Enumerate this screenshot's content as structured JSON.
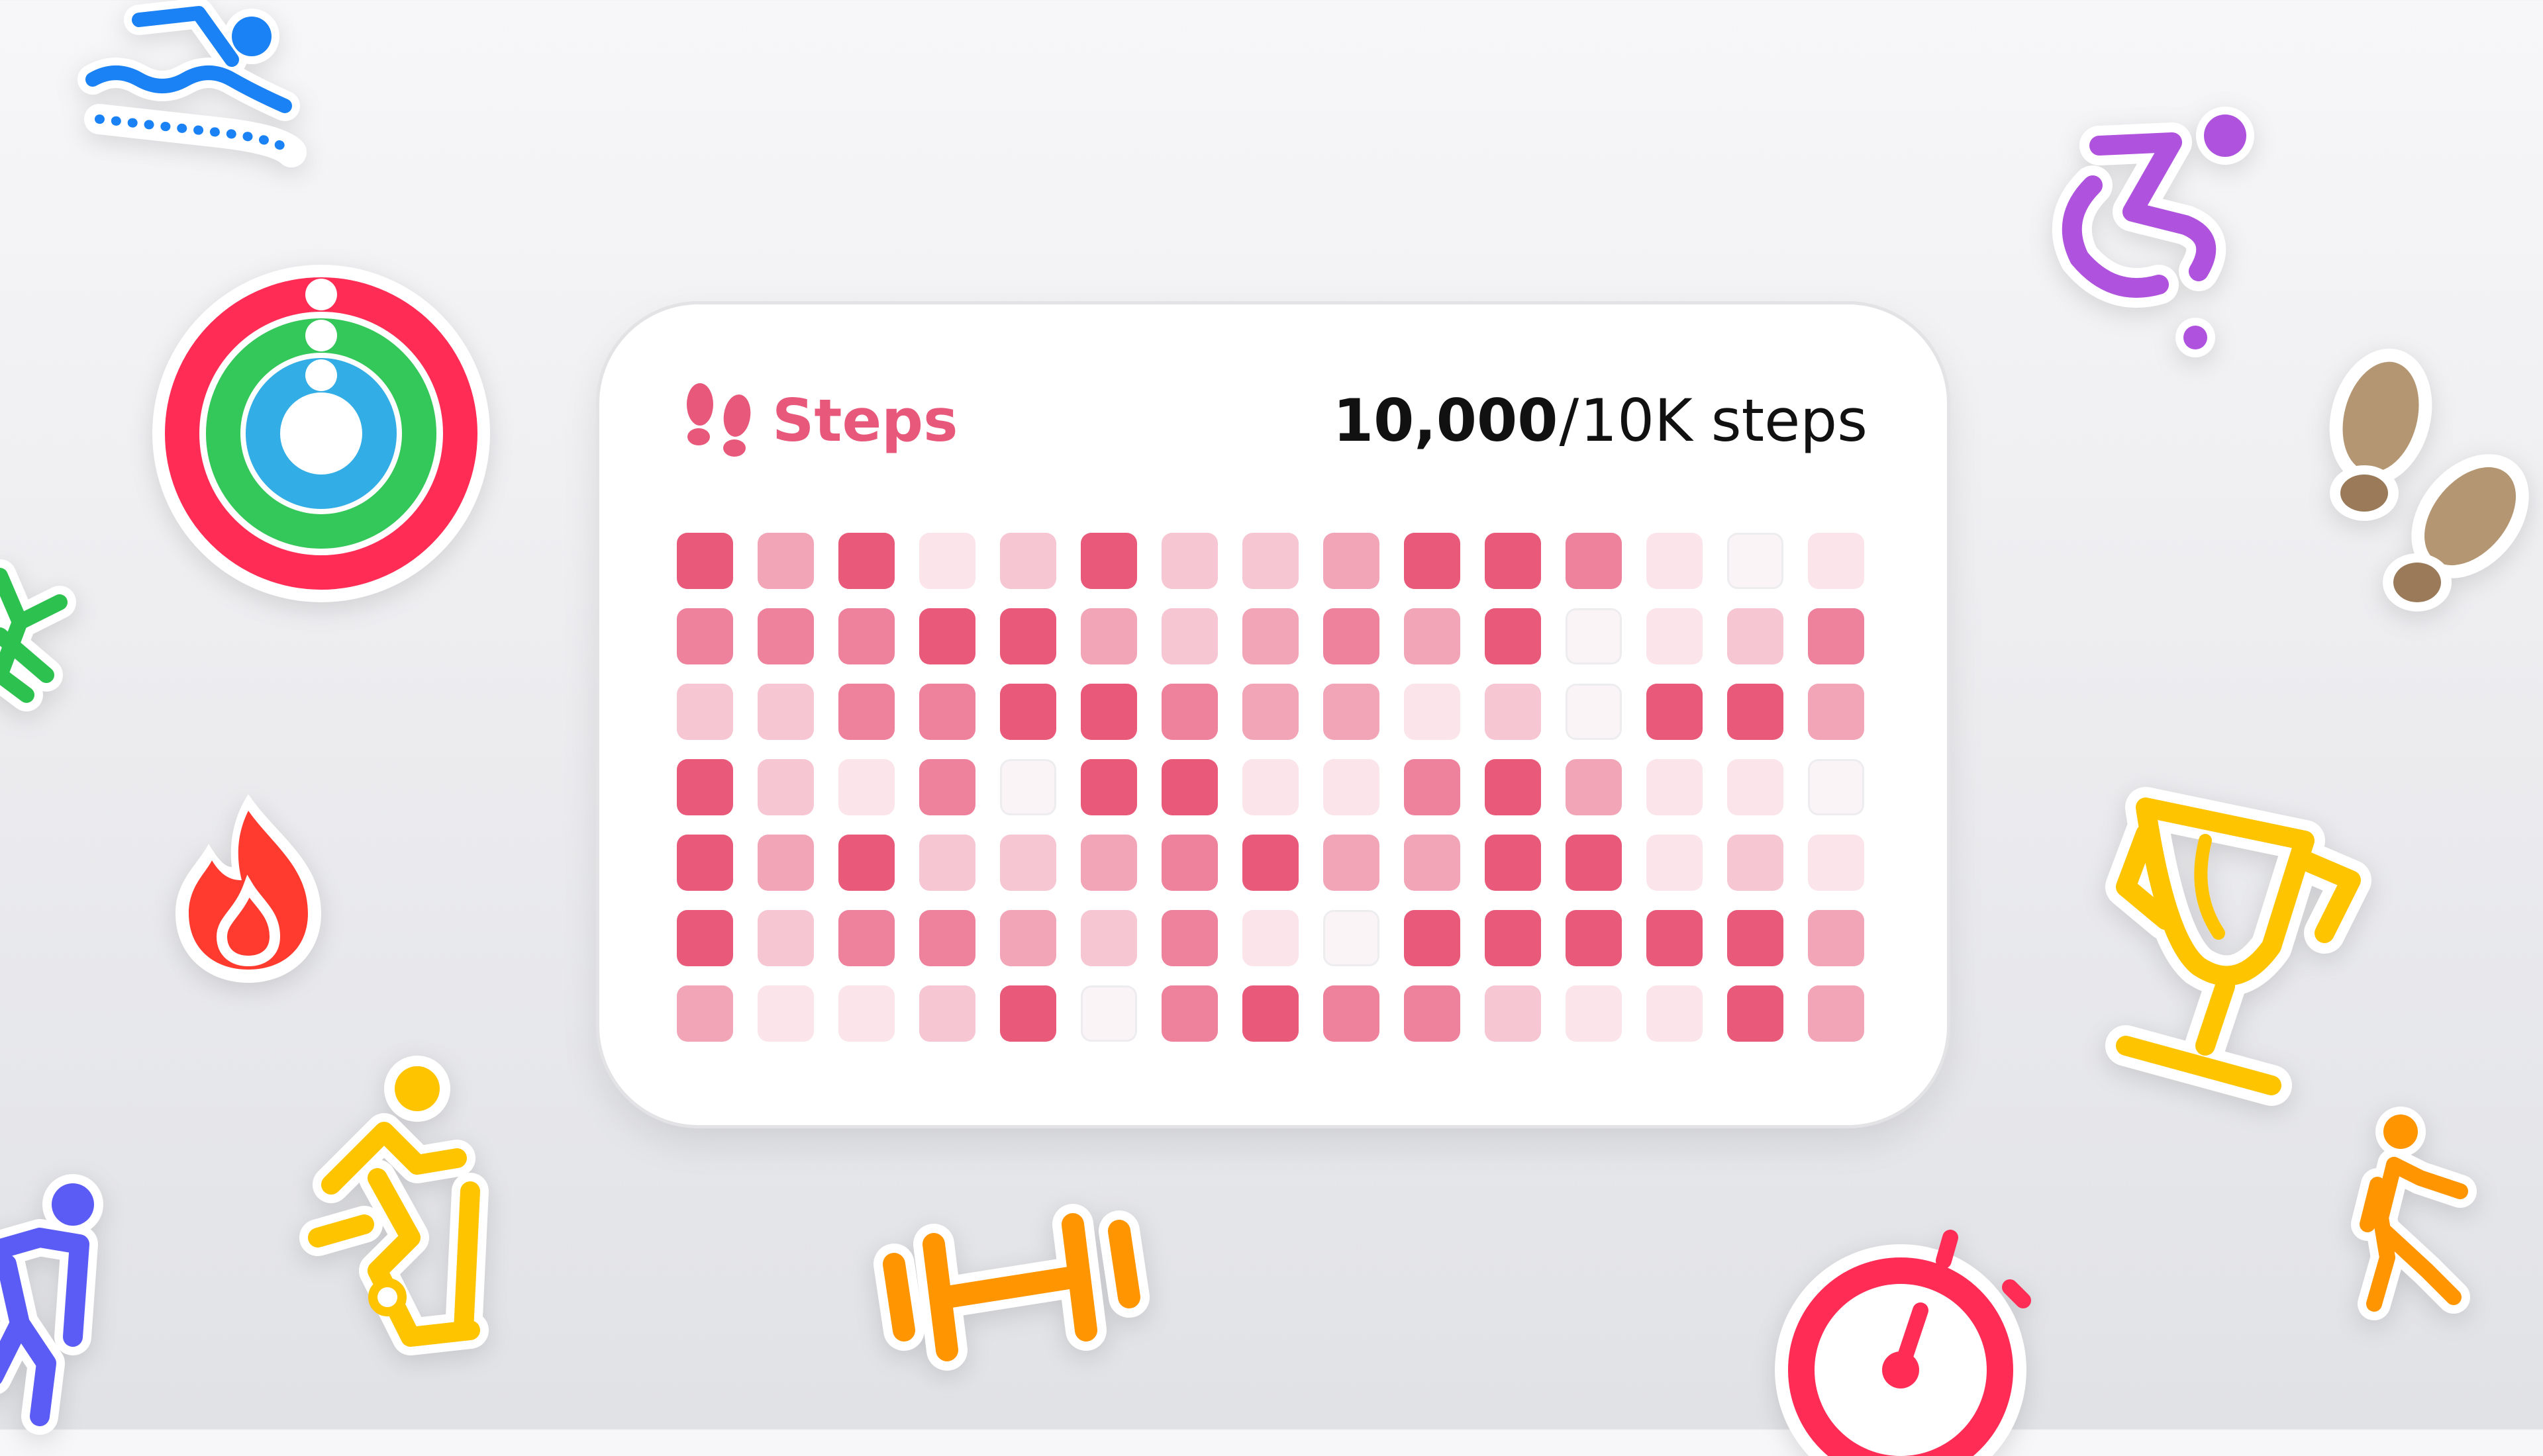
{
  "widget": {
    "title": "Steps",
    "current": "10,000",
    "separator": "/",
    "goal": "10K steps",
    "accent_color": "#e8587a"
  },
  "heatmap": {
    "rows": 7,
    "columns": 15,
    "intensity_scale": "0 = empty, 5 = full",
    "levels": [
      [
        5,
        3,
        5,
        1,
        2,
        5,
        2,
        2,
        3,
        5,
        5,
        4,
        1,
        0,
        1
      ],
      [
        4,
        4,
        4,
        5,
        5,
        3,
        2,
        3,
        4,
        3,
        5,
        0,
        1,
        2,
        4
      ],
      [
        2,
        2,
        4,
        4,
        5,
        5,
        4,
        3,
        3,
        1,
        2,
        0,
        5,
        5,
        3
      ],
      [
        5,
        2,
        1,
        4,
        0,
        5,
        5,
        1,
        1,
        4,
        5,
        3,
        1,
        1,
        0
      ],
      [
        5,
        3,
        5,
        2,
        2,
        3,
        4,
        5,
        3,
        3,
        5,
        5,
        1,
        2,
        1
      ],
      [
        5,
        2,
        4,
        4,
        3,
        2,
        4,
        1,
        0,
        5,
        5,
        5,
        5,
        5,
        3
      ],
      [
        3,
        1,
        1,
        2,
        5,
        0,
        4,
        5,
        4,
        4,
        2,
        1,
        1,
        5,
        3
      ]
    ],
    "colors": [
      "#fbf4f6",
      "#fbe4ea",
      "#f7c6d3",
      "#f3a5b8",
      "#ee829c",
      "#e95a7a"
    ]
  },
  "stickers": [
    {
      "icon": "swimming-icon",
      "color": "#1a82f5"
    },
    {
      "icon": "activity-rings-icon",
      "color": "#ff2d55"
    },
    {
      "icon": "running-icon",
      "color": "#2dc24f"
    },
    {
      "icon": "flame-icon",
      "color": "#ff3b30"
    },
    {
      "icon": "stationary-bike-icon",
      "color": "#ffc400"
    },
    {
      "icon": "hiking-icon",
      "color": "#5b5bf5"
    },
    {
      "icon": "dumbbell-icon",
      "color": "#ff9500"
    },
    {
      "icon": "stopwatch-icon",
      "color": "#ff2d55"
    },
    {
      "icon": "wheelchair-icon",
      "color": "#af52de"
    },
    {
      "icon": "footprints-icon",
      "color": "#a2845e"
    },
    {
      "icon": "trophy-icon",
      "color": "#ffc400"
    },
    {
      "icon": "walking-icon",
      "color": "#ff9500"
    }
  ]
}
